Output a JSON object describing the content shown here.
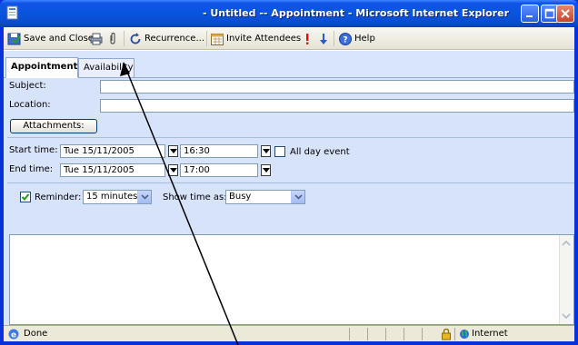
{
  "window": {
    "title": "- Untitled -- Appointment - Microsoft Internet Explorer"
  },
  "toolbar": {
    "save_close": "Save and Close",
    "recurrence": "Recurrence...",
    "invite": "Invite Attendees",
    "help": "Help"
  },
  "tabs": {
    "appointment": "Appointment",
    "availability": "Availability"
  },
  "form": {
    "subject_label": "Subject:",
    "location_label": "Location:",
    "attachments_button": "Attachments:",
    "start_label": "Start time:",
    "start_date": "Tue 15/11/2005",
    "start_time": "16:30",
    "all_day_label": "All day event",
    "end_label": "End time:",
    "end_date": "Tue 15/11/2005",
    "end_time": "17:00",
    "reminder_label": "Reminder:",
    "reminder_value": "15 minutes",
    "show_time_label": "Show time as:",
    "show_time_value": "Busy"
  },
  "status": {
    "text": "Done",
    "zone": "Internet"
  },
  "colors": {
    "titlebar": "#0a4bd0",
    "form_bg": "#d7e3f9"
  }
}
